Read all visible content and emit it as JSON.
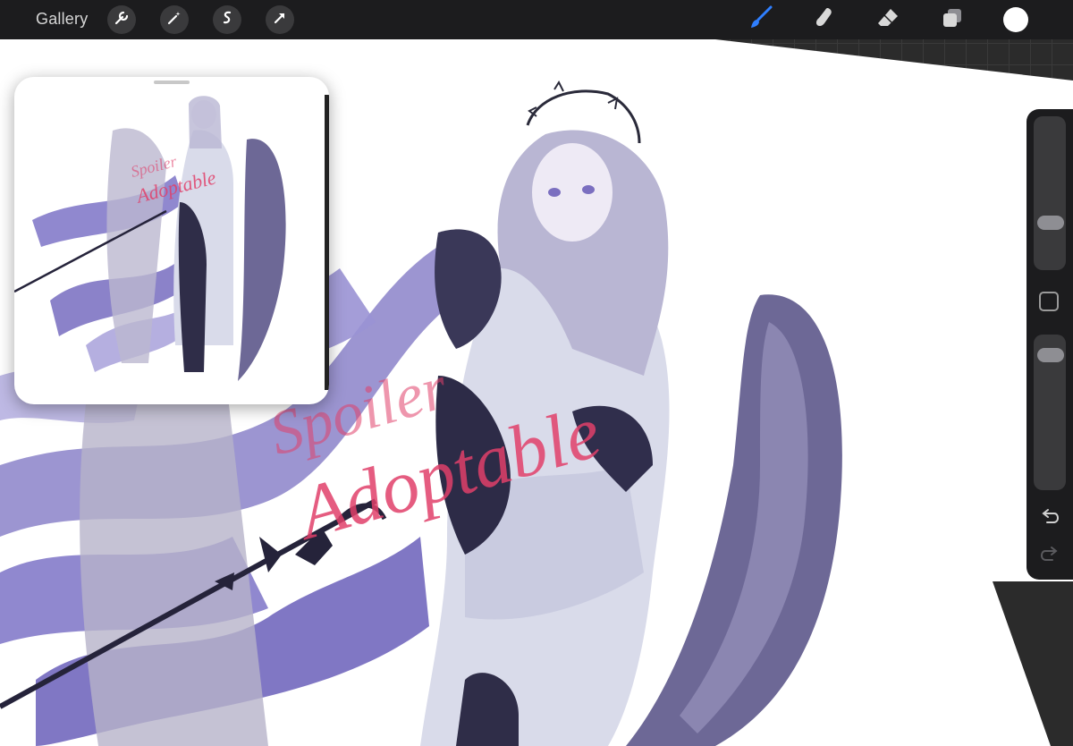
{
  "toolbar": {
    "gallery_label": "Gallery",
    "left_tools": [
      "wrench-icon",
      "magic-wand-icon",
      "selection-icon",
      "transform-arrow-icon"
    ],
    "right_tools": [
      "brush-icon",
      "smudge-icon",
      "eraser-icon",
      "layers-icon",
      "color-swatch"
    ],
    "active_tool": "brush-icon",
    "accent_color": "#2f7fff",
    "current_color": "#ffffff"
  },
  "canvas": {
    "watermark_small": "Spoiler",
    "watermark_large": "Adoptable",
    "watermark_color": "#e0406a"
  },
  "reference": {
    "watermark_small": "Spoiler",
    "watermark_large": "Adoptable"
  },
  "sidebar": {
    "brush_size": 0.28,
    "opacity": 0.93,
    "icons": [
      "modify-button",
      "undo-icon",
      "redo-icon"
    ]
  }
}
